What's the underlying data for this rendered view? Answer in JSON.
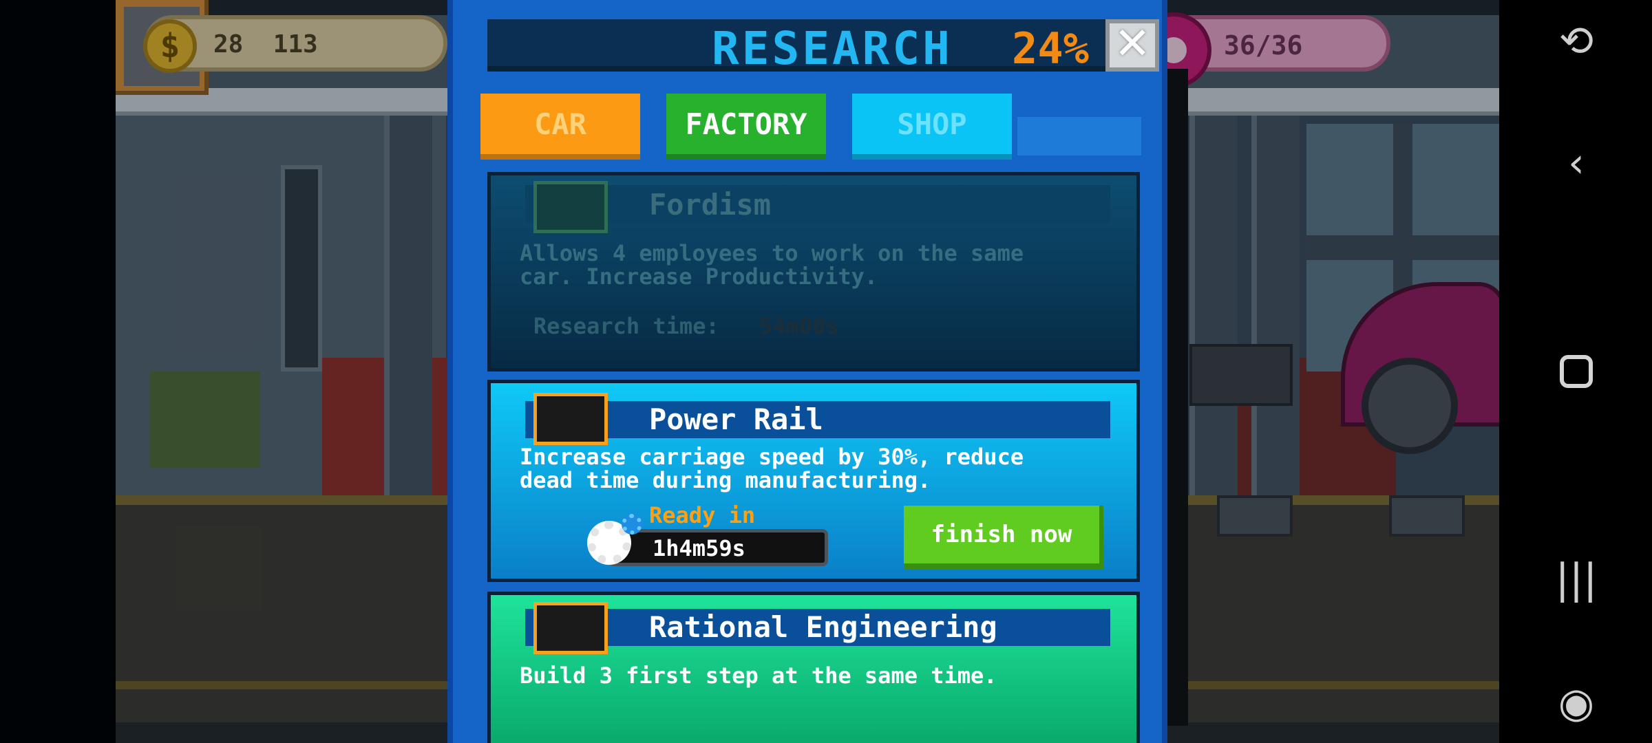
{
  "hud": {
    "coins": "28  113",
    "coin_symbol": "$",
    "donuts": "36/36"
  },
  "research": {
    "title": "RESEARCH",
    "percent": "24%",
    "close_symbol": "✕",
    "tabs": [
      {
        "label": "CAR"
      },
      {
        "label": "FACTORY"
      },
      {
        "label": "SHOP"
      }
    ],
    "cards": {
      "fordism": {
        "title": "Fordism",
        "desc": "Allows 4 employees to work on the same car. Increase Productivity.",
        "time_label": "Research time:",
        "time_value": "54m00s",
        "icon": "factory-icon"
      },
      "power_rail": {
        "title": "Power Rail",
        "desc": "Increase carriage speed by 30%, reduce dead time during manufacturing.",
        "ready_label": "Ready in",
        "timer": "1h4m59s",
        "finish_label": "finish now",
        "icon": "power-rail-icon"
      },
      "rational": {
        "title": "Rational Engineering",
        "desc": "Build 3 first step at the same time.",
        "icon": "workers-icon"
      }
    }
  },
  "navbar": {
    "rotate_icon": "rotate-icon",
    "back_symbol": "‹",
    "recent_symbol": "|||",
    "game_icon": "gamepad-icon"
  },
  "colors": {
    "panel": "#1565c8",
    "title": "#22b7f2",
    "percent": "#f28a14",
    "tab_car": "#fc9a14",
    "tab_factory": "#27b12d",
    "tab_shop": "#09c4f4",
    "finish_button": "#5fcc1f",
    "ready_label": "#ffa012"
  }
}
